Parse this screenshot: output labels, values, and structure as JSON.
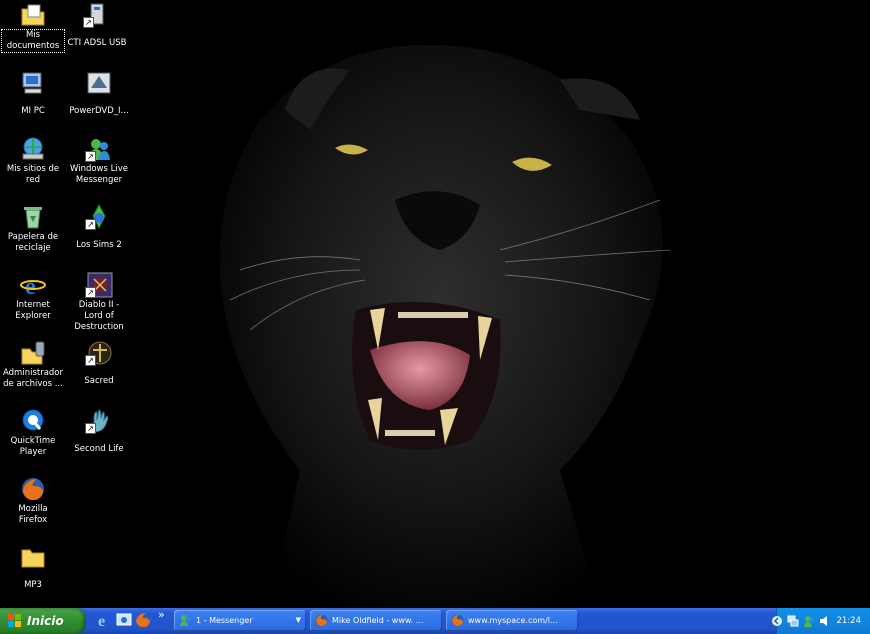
{
  "desktop": {
    "icons": [
      {
        "label": "Mis documentos",
        "icon": "my-documents-folder-icon"
      },
      {
        "label": "MI PC",
        "icon": "my-computer-icon"
      },
      {
        "label": "Mis sitios de red",
        "icon": "network-places-icon"
      },
      {
        "label": "Papelera de reciclaje",
        "icon": "recycle-bin-icon"
      },
      {
        "label": "Internet Explorer",
        "icon": "internet-explorer-icon"
      },
      {
        "label": "Administrador de archivos ...",
        "icon": "file-manager-icon"
      },
      {
        "label": "QuickTime Player",
        "icon": "quicktime-icon"
      },
      {
        "label": "Mozilla Firefox",
        "icon": "firefox-icon"
      },
      {
        "label": "MP3",
        "icon": "folder-icon"
      },
      {
        "label": "CTI ADSL USB",
        "icon": "adsl-usb-icon"
      },
      {
        "label": "PowerDVD_I...",
        "icon": "powerdvd-icon"
      },
      {
        "label": "Windows Live Messenger",
        "icon": "messenger-icon"
      },
      {
        "label": "Los Sims 2",
        "icon": "sims-icon"
      },
      {
        "label": "Diablo II - Lord of Destruction",
        "icon": "diablo-icon"
      },
      {
        "label": "Sacred",
        "icon": "sacred-icon"
      },
      {
        "label": "Second Life",
        "icon": "second-life-icon"
      }
    ]
  },
  "taskbar": {
    "start_label": "Inicio",
    "quick_launch_more": "»",
    "tasks": [
      {
        "label": "1 - Messenger",
        "icon": "messenger-icon"
      },
      {
        "label": "Mike Oldfield - www. ...",
        "icon": "firefox-icon"
      },
      {
        "label": "www.myspace.com/l...",
        "icon": "firefox-icon"
      }
    ],
    "clock": "21:24"
  },
  "colors": {
    "taskbar": "#2457d4",
    "start": "#2f8d2f",
    "tray": "#0f7ad4"
  }
}
